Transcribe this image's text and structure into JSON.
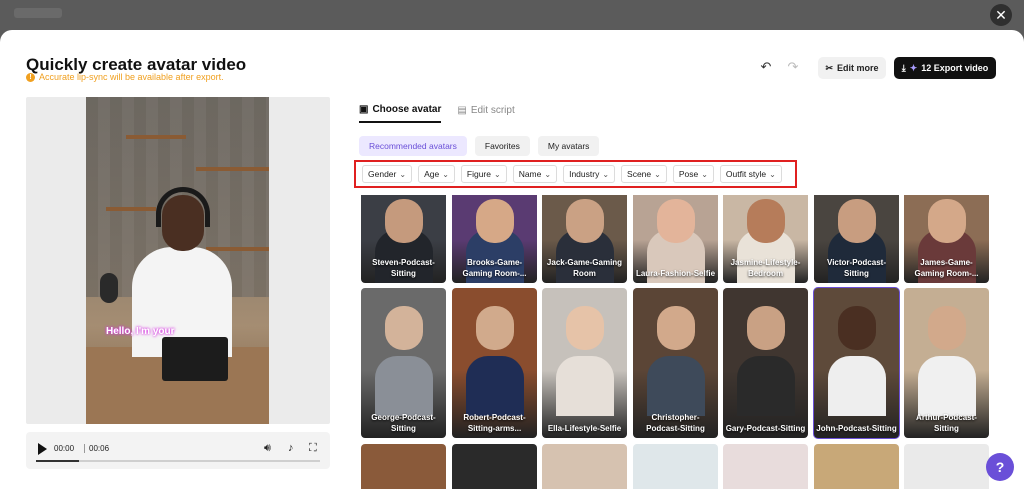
{
  "header": {
    "title": "Quickly create avatar video",
    "subtitle": "Accurate lip-sync will be available after export.",
    "edit_more_label": "Edit more",
    "export_label": "12 Export video"
  },
  "preview": {
    "caption": "Hello, I'm your",
    "current_time": "00:00",
    "duration": "00:06",
    "progress": 0.15
  },
  "tabs": [
    {
      "label": "Choose avatar",
      "icon": "person-card-icon"
    },
    {
      "label": "Edit script",
      "icon": "document-icon"
    }
  ],
  "chips": [
    "Recommended avatars",
    "Favorites",
    "My avatars"
  ],
  "filters": [
    "Gender",
    "Age",
    "Figure",
    "Name",
    "Industry",
    "Scene",
    "Pose",
    "Outfit style"
  ],
  "avatars_row1": [
    "Steven-Podcast-Sitting",
    "Brooks-Game-Gaming Room-...",
    "Jack-Game-Gaming Room",
    "Laura-Fashion-Selfie",
    "Jasmine-Lifestyle-Bedroom",
    "Victor-Podcast-Sitting",
    "James-Game-Gaming Room-..."
  ],
  "avatars_row2": [
    "George-Podcast-Sitting",
    "Robert-Podcast-Sitting-arms...",
    "Ella-Lifestyle-Selfie",
    "Christopher-Podcast-Sitting",
    "Gary-Podcast-Sitting",
    "John-Podcast-Sitting",
    "Arthur-Podcast-Sitting"
  ],
  "colors": {
    "accent": "#6a4fd8",
    "warning": "#f0a020",
    "filter_highlight": "#e02020"
  }
}
